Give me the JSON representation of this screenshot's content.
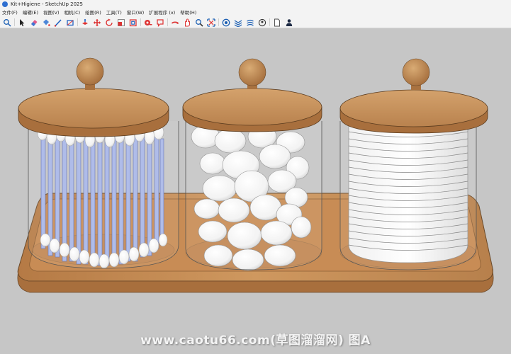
{
  "window": {
    "title": "Kit+Higiene - SketchUp 2025"
  },
  "menu": [
    "文件(F)",
    "编辑(E)",
    "视图(V)",
    "相机(C)",
    "绘图(R)",
    "工具(T)",
    "窗口(W)",
    "扩展程序 (x)",
    "帮助(H)"
  ],
  "toolbar": {
    "icons": [
      "zoom-search-icon",
      "select-arrow-icon",
      "eraser-icon",
      "paint-bucket-icon",
      "line-pencil-icon",
      "rectangle-icon",
      "push-pull-icon",
      "move-icon",
      "rotate-icon",
      "scale-icon",
      "offset-icon",
      "tape-measure-icon",
      "text-icon",
      "orbit-icon",
      "pan-icon",
      "zoom-icon",
      "zoom-extents-icon",
      "3d-warehouse-icon",
      "extension-warehouse-icon",
      "layout-icon",
      "account-icon",
      "new-file-icon",
      "user-icon"
    ]
  },
  "viewport": {
    "background": "#c6c6c6",
    "wood_color": "#c8905a",
    "glass_color": "#ffffff",
    "swab_color": "#a9b7e8"
  },
  "watermark": "www.caotu66.com(草图溜溜网) 图A"
}
